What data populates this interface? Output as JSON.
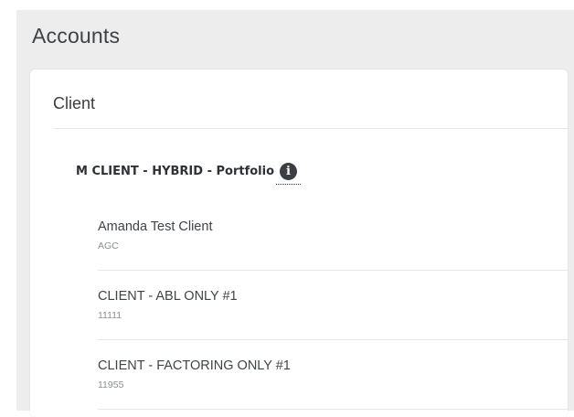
{
  "page": {
    "title": "Accounts"
  },
  "card": {
    "title": "Client"
  },
  "portfolio": {
    "name": "M CLIENT - HYBRID - Portfolio",
    "info_icon": "info-icon",
    "info_glyph": "i"
  },
  "clients": [
    {
      "name": "Amanda Test Client",
      "code": "AGC"
    },
    {
      "name": "CLIENT - ABL ONLY #1",
      "code": "11111"
    },
    {
      "name": "CLIENT - FACTORING ONLY #1",
      "code": "11955"
    }
  ],
  "colors": {
    "page_background": "#ededee",
    "card_background": "#ffffff",
    "divider": "#e6e7e9",
    "info_icon": "#3b3f44"
  }
}
